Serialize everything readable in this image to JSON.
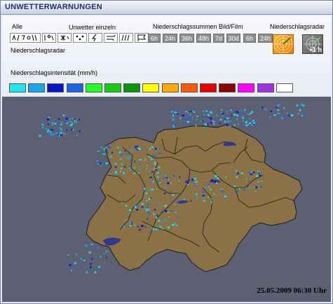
{
  "window": {
    "title": "UNWETTERWARNUNGEN"
  },
  "filters": {
    "all_label": "Alle",
    "single_label": "Unwetter einzeln",
    "radar_label": "Niederschlagsradar"
  },
  "precip_sums": {
    "label": "Niederschlagssummen Bild/Film",
    "buttons": [
      "6h",
      "24h",
      "36h",
      "48h",
      "7d",
      "30d",
      "6h",
      "24h"
    ]
  },
  "radar": {
    "label": "Niederschlagsradar",
    "plus_label": "+1 h"
  },
  "intensity": {
    "label": "Niederschlagsintensität (mm/h)",
    "colors": [
      "#22e6ee",
      "#1aa6ee",
      "#0a14c8",
      "#1e64e6",
      "#22ff22",
      "#16cc16",
      "#0a960a",
      "#ffff00",
      "#ffaa00",
      "#ff5a00",
      "#e60000",
      "#8c0000",
      "#ff00ff",
      "#a030e6",
      "#ffffff"
    ]
  },
  "map": {
    "timestamp": "25.05.2009 06:30 Uhr"
  }
}
